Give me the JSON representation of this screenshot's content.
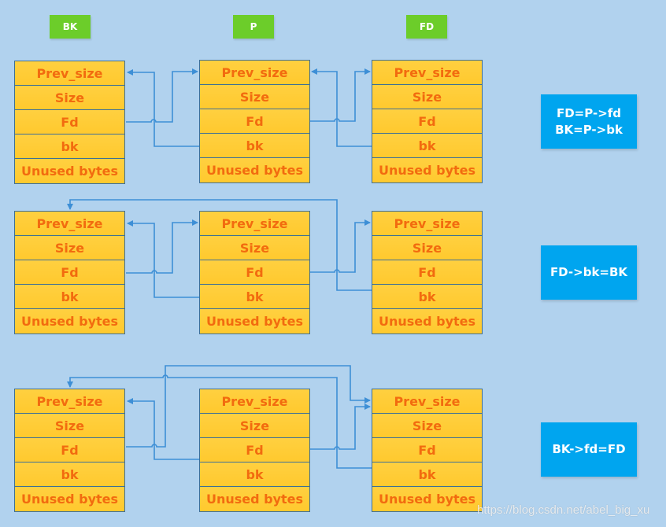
{
  "header_labels": {
    "bk": "BK",
    "p": "P",
    "fd": "FD"
  },
  "chunk_fields": [
    "Prev_size",
    "Size",
    "Fd",
    "bk",
    "Unused bytes"
  ],
  "notes": {
    "step1": [
      "FD=P->fd",
      "BK=P->bk"
    ],
    "step2": [
      "FD->bk=BK"
    ],
    "step3": [
      "BK->fd=FD"
    ]
  },
  "colors": {
    "background": "#b1d2ee",
    "label_green": "#6ccd2a",
    "chunk_fill": "#ffcc33",
    "chunk_text": "#f26b0f",
    "note_blue": "#00a5ef",
    "arrow_blue": "#3d8fd6"
  },
  "watermark": "https://blog.csdn.net/abel_big_xu"
}
